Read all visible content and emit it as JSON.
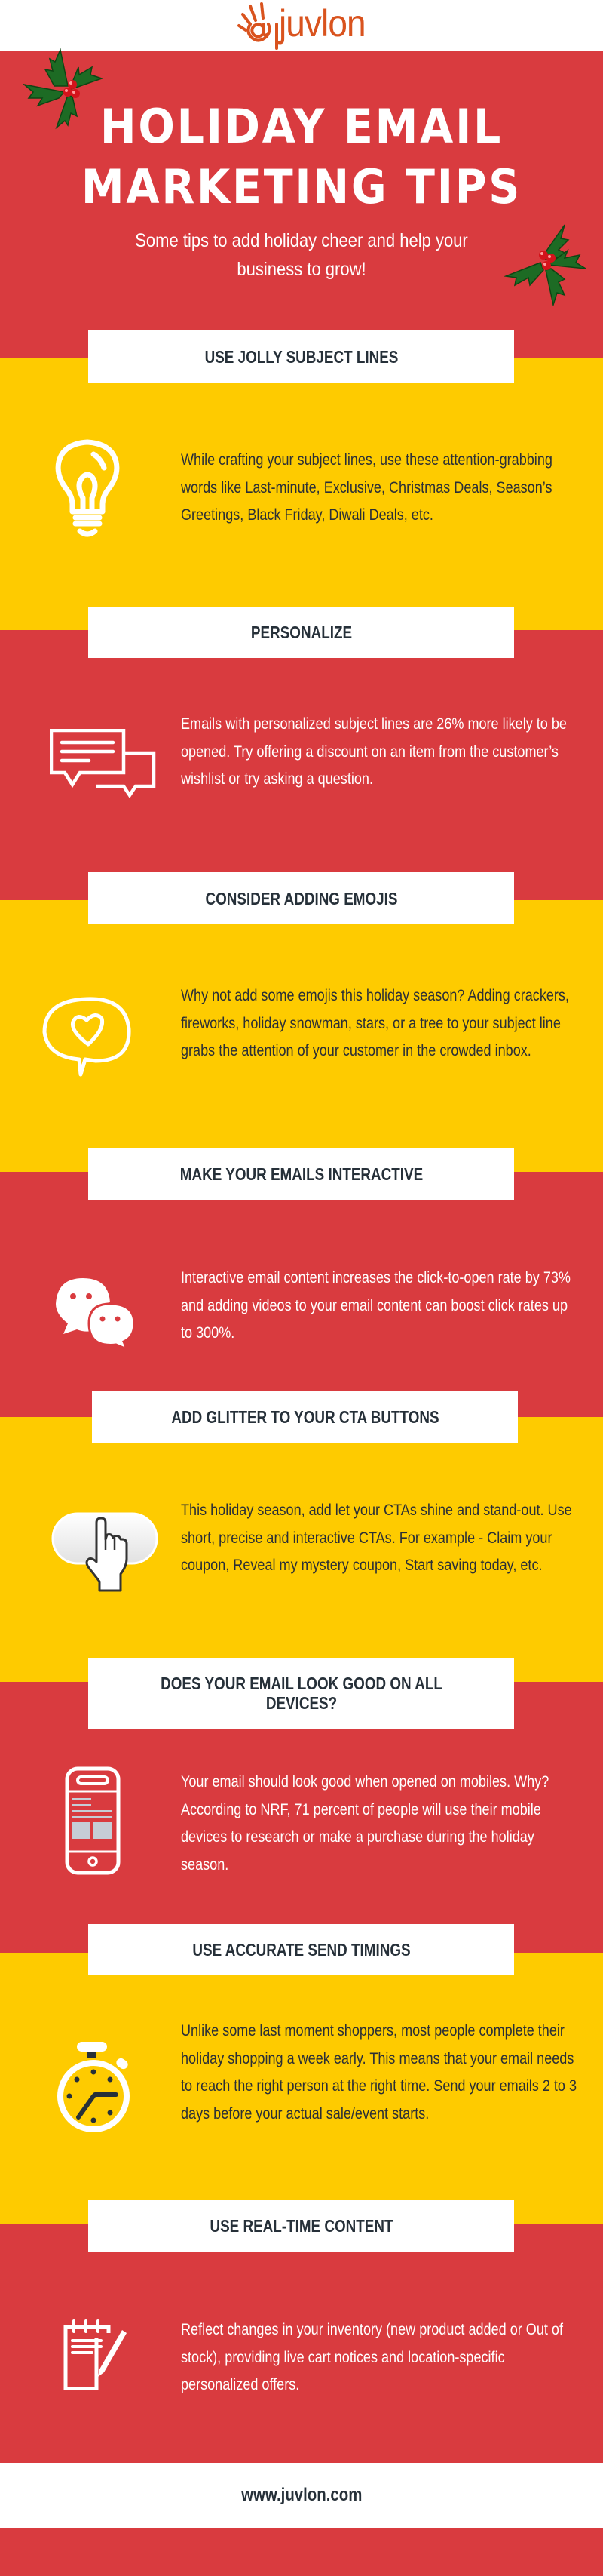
{
  "brand": {
    "logo_text": "juvlon",
    "colors": {
      "red": "#d93b3f",
      "yellow": "#fecb00",
      "white": "#ffffff",
      "dark_text": "#263039",
      "logo_orange": "#d9531e"
    }
  },
  "hero": {
    "title_line1": "HOLIDAY EMAIL",
    "title_line2": "MARKETING TIPS",
    "subtitle": "Some tips to add holiday cheer and help your business to grow!"
  },
  "tips": [
    {
      "heading": "USE JOLLY SUBJECT LINES",
      "icon": "lightbulb-icon",
      "background": "yellow",
      "text": "While crafting your subject lines, use these attention-grabbing words like Last-minute, Exclusive, Christmas Deals, Season’s Greetings, Black Friday, Diwali Deals, etc."
    },
    {
      "heading": "PERSONALIZE",
      "icon": "speech-bubbles-icon",
      "background": "red",
      "text": "Emails with personalized subject lines are 26% more likely to be opened. Try offering a discount on an item from the customer’s wishlist or try asking a question."
    },
    {
      "heading": "CONSIDER ADDING EMOJIS",
      "icon": "heart-bubble-icon",
      "background": "yellow",
      "text": "Why not add some emojis this holiday season? Adding crackers, fireworks, holiday snowman, stars, or a tree to your subject line grabs the attention of your customer in the crowded inbox."
    },
    {
      "heading": "MAKE YOUR EMAILS INTERACTIVE",
      "icon": "chat-icon",
      "background": "red",
      "text": "Interactive email content increases the click-to-open rate by 73% and adding videos to your email content can boost click rates up to 300%."
    },
    {
      "heading": "ADD GLITTER TO YOUR CTA BUTTONS",
      "icon": "cta-button-cursor-icon",
      "background": "yellow",
      "text": "This holiday season, add let your CTAs shine and stand-out. Use short, precise and interactive CTAs. For example - Claim your coupon, Reveal my mystery coupon, Start saving today, etc."
    },
    {
      "heading": "DOES YOUR EMAIL LOOK GOOD ON ALL DEVICES?",
      "icon": "mobile-phone-icon",
      "background": "red",
      "text": "Your email should look good when opened on mobiles. Why? According to NRF, 71 percent of people will use their mobile devices to research or make a purchase during the holiday season."
    },
    {
      "heading": "USE ACCURATE SEND TIMINGS",
      "icon": "stopwatch-icon",
      "background": "yellow",
      "text": "Unlike some last moment shoppers, most people complete their holiday shopping a week early. This means that your email needs to reach the right person at the right time. Send your emails 2 to 3 days before your actual sale/event starts."
    },
    {
      "heading": "USE REAL-TIME CONTENT",
      "icon": "notepad-pencil-icon",
      "background": "red",
      "text": "Reflect changes in your inventory (new product added or Out of stock), providing live cart notices and location-specific personalized offers."
    }
  ],
  "footer": {
    "url": "www.juvlon.com"
  }
}
